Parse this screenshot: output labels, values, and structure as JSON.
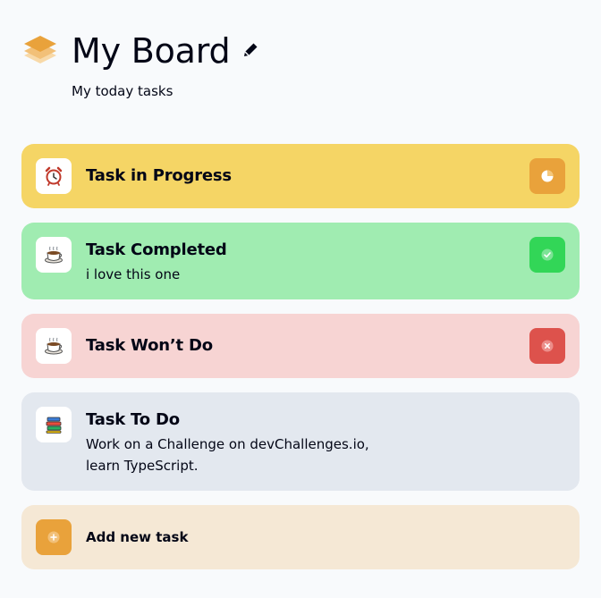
{
  "header": {
    "title": "My Board",
    "subtitle": "My today tasks"
  },
  "tasks": [
    {
      "title": "Task in Progress",
      "description": "",
      "icon": "alarm-clock-icon",
      "status": "in-progress",
      "status_icon": "progress-pie-icon",
      "card_color": "#F5D565",
      "status_color": "#E9A23B"
    },
    {
      "title": "Task Completed",
      "description": "i love this one",
      "icon": "coffee-cup-icon",
      "status": "completed",
      "status_icon": "checkmark-icon",
      "card_color": "#A0ECB1",
      "status_color": "#32D657"
    },
    {
      "title": "Task Won’t Do",
      "description": "",
      "icon": "coffee-cup-icon",
      "status": "wont-do",
      "status_icon": "close-x-icon",
      "card_color": "#F7D4D3",
      "status_color": "#DD524C"
    },
    {
      "title": "Task To Do",
      "description_line1": "Work on a Challenge on devChallenges.io,",
      "description_line2": "learn TypeScript.",
      "icon": "books-icon",
      "status": "to-do",
      "card_color": "#E3E8EF"
    }
  ],
  "add_task": {
    "label": "Add new task",
    "icon": "plus-circle-icon",
    "card_color": "#F5E8D5",
    "icon_color": "#E9A23B"
  }
}
